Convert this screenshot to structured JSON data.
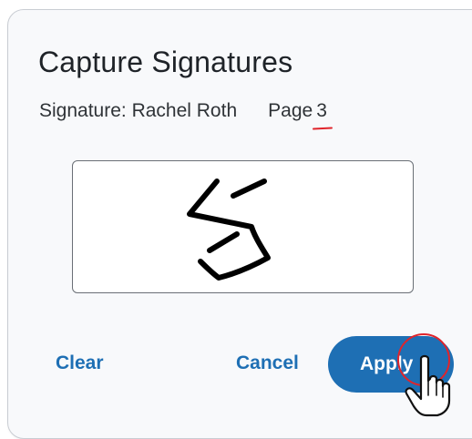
{
  "dialog": {
    "title": "Capture Signatures",
    "signature_label": "Signature: Rachel Roth",
    "page_label": "Page",
    "page_number": "3"
  },
  "buttons": {
    "clear_label": "Clear",
    "cancel_label": "Cancel",
    "apply_label": "Apply"
  },
  "cursor": {
    "type": "hand-pointer-icon"
  },
  "colors": {
    "accent": "#1e6fb4",
    "highlight": "#e0242b",
    "dialog_background": "#f8f9fb"
  }
}
